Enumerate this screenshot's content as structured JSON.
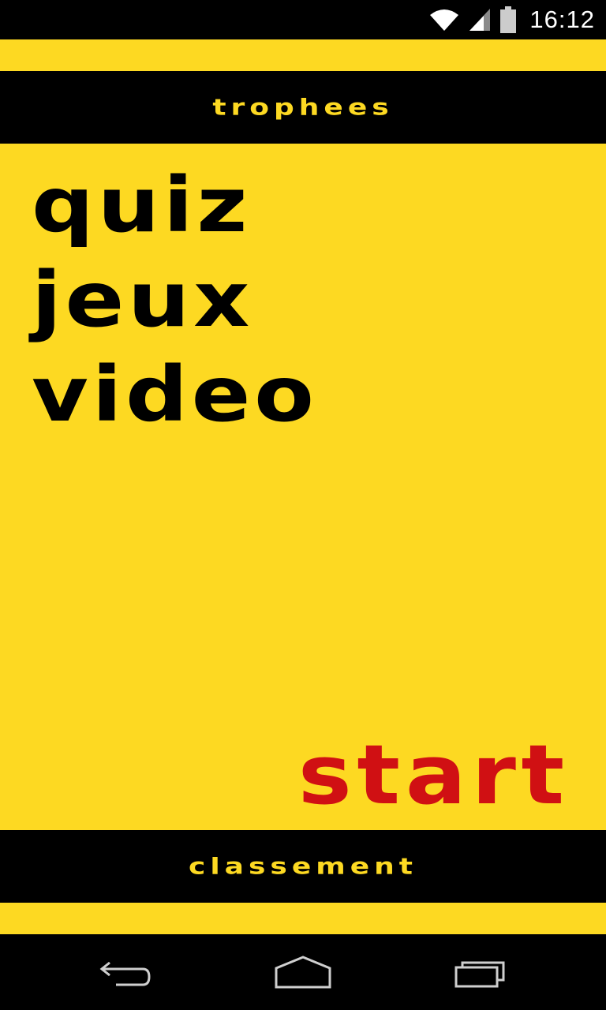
{
  "status_bar": {
    "time": "16:12",
    "icons": [
      "wifi-icon",
      "signal-icon",
      "battery-icon"
    ]
  },
  "header": {
    "trophies_label": "Trophees"
  },
  "menu": {
    "items": [
      {
        "label": "Quiz"
      },
      {
        "label": "Jeux"
      },
      {
        "label": "Video"
      }
    ]
  },
  "start_label": "Start",
  "footer": {
    "ranking_label": "Classement"
  },
  "nav_bar": {
    "icons": [
      "back-icon",
      "home-icon",
      "recents-icon"
    ]
  },
  "colors": {
    "background": "#fdd922",
    "bar": "#000000",
    "accent_red": "#d01013",
    "status_text": "#ffffff"
  }
}
